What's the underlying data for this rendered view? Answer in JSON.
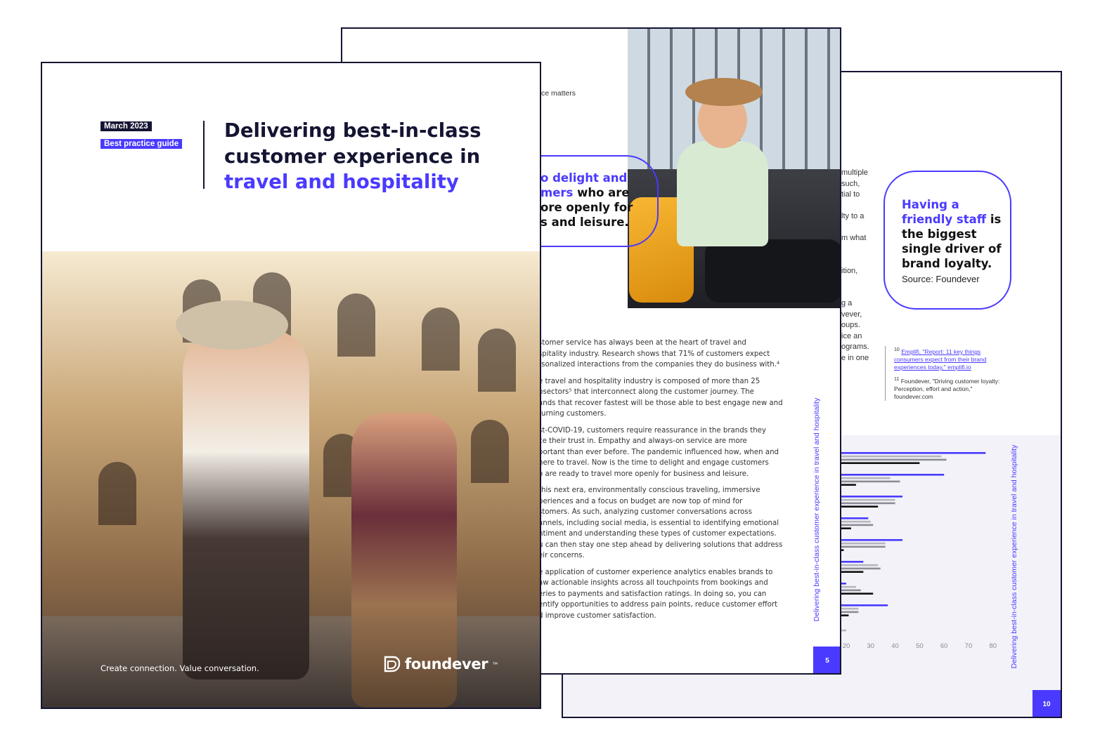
{
  "back_page": {
    "clipped_text_lines": [
      "multiple",
      "such,",
      "tial to",
      "",
      "lty to a",
      "",
      "m what",
      "",
      "",
      "ition,",
      "",
      "",
      "g a",
      "vever,",
      "oups.",
      "ice an",
      "ograms.",
      "e in one"
    ],
    "quote": {
      "accent": "Having a friendly staff",
      "rest": "is the biggest single driver of brand loyalty.",
      "source": "Source: Foundever"
    },
    "footnotes": {
      "fn1_number": "10",
      "fn1_text": "Emplifi, \"Report: 11 key things consumers expect from their brand experiences today,\" emplifi.io",
      "fn2_number": "11",
      "fn2_text": "Foundever, \"Driving customer loyalty: Perception, effort and action,\" foundever.com"
    },
    "side_title": "Delivering best-in-class customer experience in travel and hospitality",
    "page_number": "10"
  },
  "chart_data": {
    "type": "bar",
    "orientation": "horizontal",
    "x_ticks": [
      "20",
      "30",
      "40",
      "50",
      "60",
      "70",
      "80"
    ],
    "xlim": [
      0,
      80
    ],
    "series": [
      {
        "color": "#4a3aff",
        "values": [
          77,
          60,
          43,
          29,
          43,
          27,
          20,
          37,
          0
        ]
      },
      {
        "color": "#b5b5be",
        "values": [
          59,
          38,
          40,
          30,
          36,
          33,
          24,
          25,
          20
        ]
      },
      {
        "color": "#8c8c96",
        "values": [
          61,
          42,
          40,
          31,
          36,
          34,
          26,
          25,
          18
        ]
      },
      {
        "color": "#111111",
        "values": [
          50,
          24,
          33,
          22,
          19,
          27,
          31,
          21,
          14
        ]
      }
    ],
    "grid": false
  },
  "middle_page": {
    "clip_top": "ce matters",
    "callout": {
      "line1_accent": "o delight and",
      "line2_accent": "mers",
      "line2_rest": " who are",
      "line3": "ore openly for",
      "line4": "s and leisure."
    },
    "paragraphs": [
      [
        "stomer service has always been at the heart of travel and",
        "spitality industry. Research shows that 71% of customers expect",
        "rsonalized interactions from the companies they do business with.⁴"
      ],
      [
        "e travel and hospitality industry is composed of more than 25",
        "bsectors⁵ that interconnect along the customer journey. The",
        "ands that recover fastest will be those able to best engage new and",
        "turning customers."
      ],
      [
        "st-COVID-19, customers require reassurance in the brands they",
        "ce their trust in. Empathy and always-on service are more",
        "portant than ever before. The pandemic influenced how, when and",
        "here to travel. Now is the time to delight and engage customers",
        "o are ready to travel more openly for business and leisure."
      ],
      [
        "this next era, environmentally conscious traveling, immersive",
        "periences and a focus on budget are now top of mind for",
        "stomers. As such, analyzing customer conversations across",
        "annels, including social media, is essential to identifying emotional",
        "ntiment and understanding these types of customer expectations.",
        "u can then stay one step ahead by delivering solutions that address",
        "eir concerns."
      ],
      [
        "e application of customer experience analytics enables brands to",
        "aw actionable insights across all touchpoints from bookings and",
        "eries to payments and satisfaction ratings. In doing so, you can",
        "entify opportunities to address pain points, reduce customer effort",
        "d improve customer satisfaction."
      ]
    ],
    "side_title": "Delivering best-in-class customer experience in travel and hospitality",
    "page_number": "5"
  },
  "front_page": {
    "date_badge": "March 2023",
    "type_badge": "Best practice guide",
    "title_line1": "Delivering best-in-class",
    "title_line2": "customer experience in",
    "title_line3_accent": "travel and hospitality",
    "tagline": "Create connection. Value conversation.",
    "brand_name": "foundever",
    "brand_tm": "™"
  },
  "colors": {
    "accent": "#4a3aff",
    "navy": "#141433"
  },
  "icons": {
    "brand_logo": "foundever-logo-icon"
  }
}
